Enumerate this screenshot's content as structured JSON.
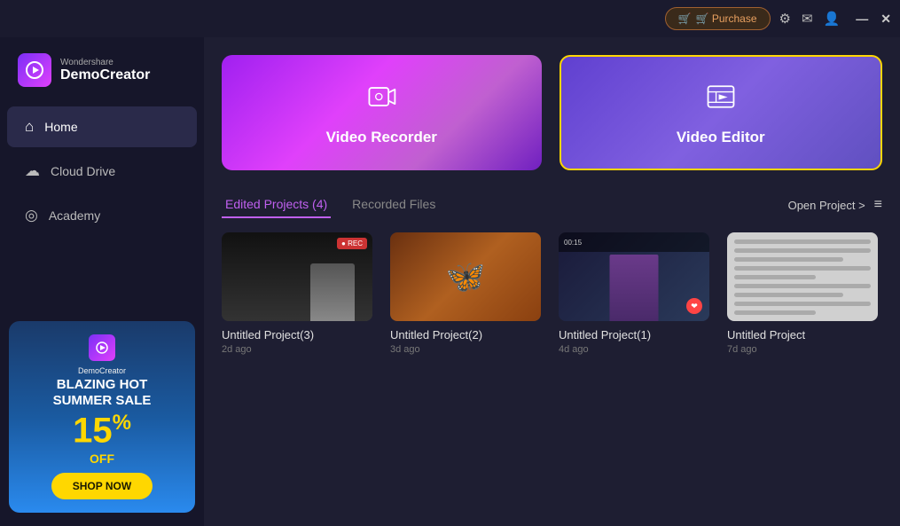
{
  "titleBar": {
    "purchaseLabel": "🛒 Purchase",
    "settingsIcon": "⚙",
    "mailIcon": "✉",
    "profileIcon": "👤",
    "minimizeIcon": "—",
    "closeIcon": "✕"
  },
  "sidebar": {
    "logoSub": "Wondershare",
    "logoMain": "DemoCreator",
    "navItems": [
      {
        "id": "home",
        "label": "Home",
        "icon": "⌂",
        "active": true
      },
      {
        "id": "cloud-drive",
        "label": "Cloud Drive",
        "icon": "☁",
        "active": false
      },
      {
        "id": "academy",
        "label": "Academy",
        "icon": "◎",
        "active": false
      }
    ],
    "ad": {
      "brand": "DemoCreator",
      "titleLine1": "BLAZING HOT",
      "titleLine2": "SUMMER SALE",
      "discount": "15",
      "discountSymbol": "%",
      "off": "OFF",
      "shopBtn": "SHOP NOW"
    }
  },
  "heroCards": [
    {
      "id": "video-recorder",
      "label": "Video Recorder",
      "type": "recorder"
    },
    {
      "id": "video-editor",
      "label": "Video Editor",
      "type": "editor"
    }
  ],
  "tabs": {
    "items": [
      {
        "id": "edited-projects",
        "label": "Edited Projects (4)",
        "active": true
      },
      {
        "id": "recorded-files",
        "label": "Recorded Files",
        "active": false
      }
    ],
    "openProject": "Open Project >",
    "gridIcon": "≡"
  },
  "projects": [
    {
      "id": "proj3",
      "name": "Untitled Project(3)",
      "time": "2d ago",
      "thumbType": "dark-person"
    },
    {
      "id": "proj2",
      "name": "Untitled Project(2)",
      "time": "3d ago",
      "thumbType": "butterfly"
    },
    {
      "id": "proj1",
      "name": "Untitled Project(1)",
      "time": "4d ago",
      "thumbType": "person-badge"
    },
    {
      "id": "proj0",
      "name": "Untitled Project",
      "time": "7d ago",
      "thumbType": "document"
    }
  ],
  "colors": {
    "accent": "#c060f0",
    "gold": "#ffd700",
    "sidebar": "#16162a",
    "bg": "#1e1e32"
  }
}
